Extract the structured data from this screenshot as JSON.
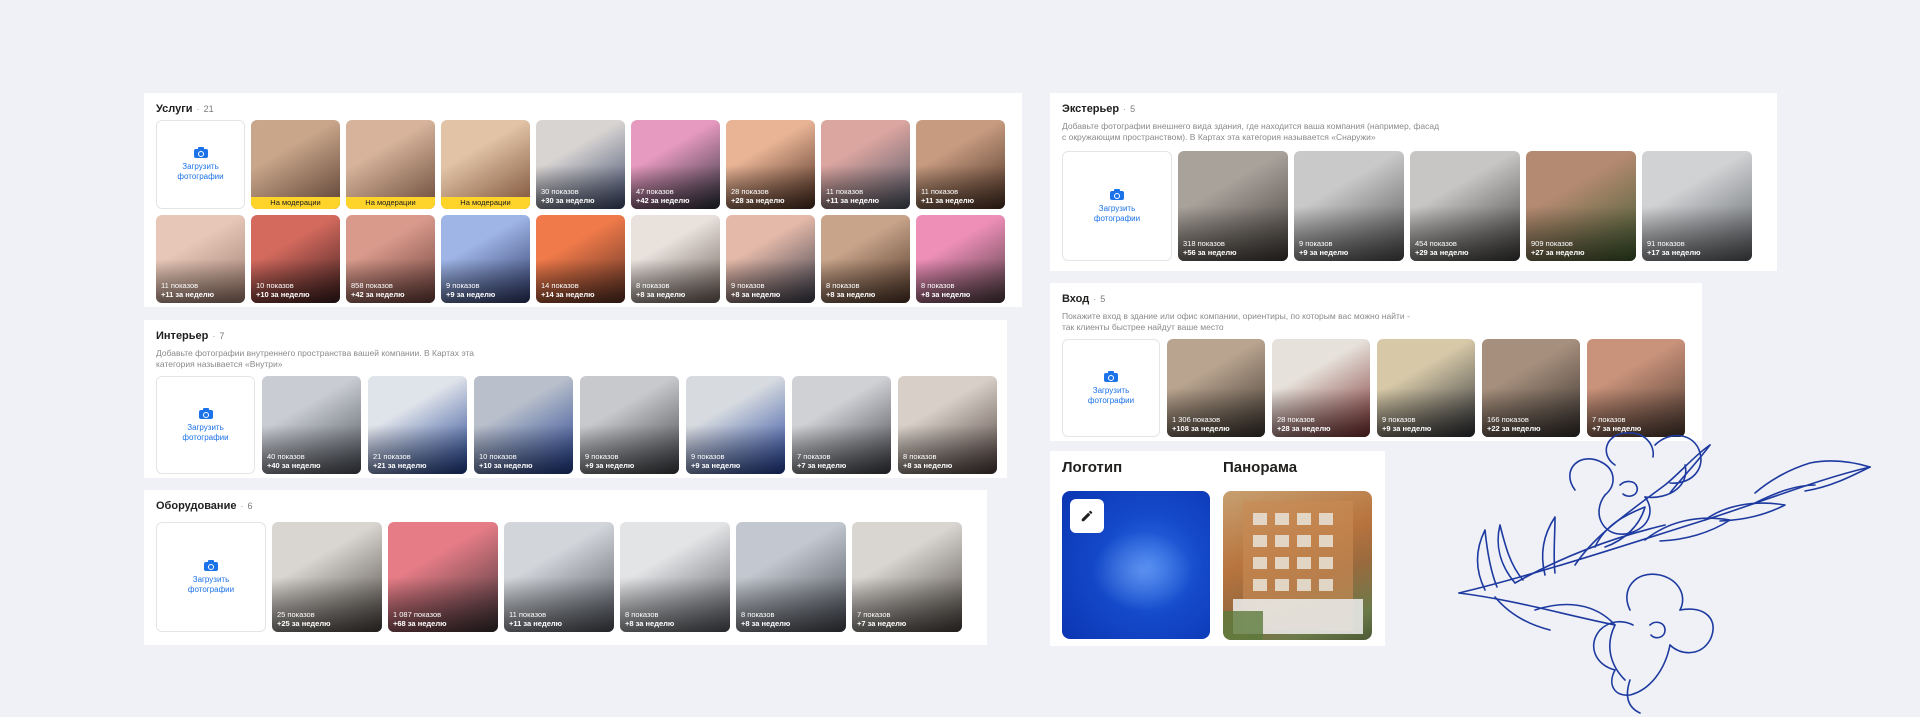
{
  "colors": {
    "accent": "#1c72e8",
    "moderation": "#fed42b",
    "background": "#eff1f6",
    "flower": "#1e3aa0"
  },
  "upload_label": "Загрузить фотографии",
  "sections": {
    "services": {
      "title": "Услуги",
      "count": "21",
      "tiles": [
        {
          "views": "",
          "week": "",
          "moderation": "На модерации",
          "c1": "#c9a68a",
          "c2": "#5b4033"
        },
        {
          "views": "",
          "week": "",
          "moderation": "На модерации",
          "c1": "#d6b39a",
          "c2": "#6a4a3a"
        },
        {
          "views": "",
          "week": "",
          "moderation": "На модерации",
          "c1": "#e2c3a6",
          "c2": "#7a5037"
        },
        {
          "views": "30 показов",
          "week": "+30 за неделю",
          "moderation": "",
          "c1": "#d8d4d2",
          "c2": "#3e4b6d"
        },
        {
          "views": "47 показов",
          "week": "+42 за неделю",
          "moderation": "",
          "c1": "#e79ac0",
          "c2": "#2c2f3a"
        },
        {
          "views": "28 показов",
          "week": "+28 за неделю",
          "moderation": "",
          "c1": "#e9b496",
          "c2": "#4a2c1e"
        },
        {
          "views": "11 показов",
          "week": "+11 за неделю",
          "moderation": "",
          "c1": "#dba5a0",
          "c2": "#4d5563"
        },
        {
          "views": "11 показов",
          "week": "+11 за неделю",
          "moderation": "",
          "c1": "#c69b80",
          "c2": "#4b3022"
        },
        {
          "views": "11 показов",
          "week": "+11 за неделю",
          "moderation": "",
          "c1": "#e7c8b8",
          "c2": "#9b7a6c"
        },
        {
          "views": "10 показов",
          "week": "+10 за неделю",
          "moderation": "",
          "c1": "#d46a5e",
          "c2": "#3b1d1d"
        },
        {
          "views": "858 показов",
          "week": "+42 за неделю",
          "moderation": "",
          "c1": "#d99a8c",
          "c2": "#6b3f3a"
        },
        {
          "views": "9 показов",
          "week": "+9 за неделю",
          "moderation": "",
          "c1": "#9fb5e6",
          "c2": "#2b3766"
        },
        {
          "views": "14 показов",
          "week": "+14 за неделю",
          "moderation": "",
          "c1": "#f07a4a",
          "c2": "#5a3023"
        },
        {
          "views": "8 показов",
          "week": "+8 за неделю",
          "moderation": "",
          "c1": "#e8e1dc",
          "c2": "#6d5e57"
        },
        {
          "views": "9 показов",
          "week": "+8 за неделю",
          "moderation": "",
          "c1": "#e4b9a9",
          "c2": "#3a3c4a"
        },
        {
          "views": "8 показов",
          "week": "+8 за неделю",
          "moderation": "",
          "c1": "#c8a48a",
          "c2": "#4f3526"
        },
        {
          "views": "8 показов",
          "week": "+8 за неделю",
          "moderation": "",
          "c1": "#ee8fb8",
          "c2": "#4c3a3f"
        }
      ]
    },
    "interior": {
      "title": "Интерьер",
      "count": "7",
      "desc": "Добавьте фотографии внутреннего пространства вашей компании. В Картах эта категория называется «Внутри»",
      "tiles": [
        {
          "views": "40 показов",
          "week": "+40 за неделю",
          "c1": "#c9ccd3",
          "c2": "#4b4f57"
        },
        {
          "views": "21 показов",
          "week": "+21 за неделю",
          "c1": "#dfe3ea",
          "c2": "#1b3d8f"
        },
        {
          "views": "10 показов",
          "week": "+10 за неделю",
          "c1": "#b9c0cc",
          "c2": "#1c3a8c"
        },
        {
          "views": "9 показов",
          "week": "+9 за неделю",
          "c1": "#c7c9cc",
          "c2": "#3d3f44"
        },
        {
          "views": "9 показов",
          "week": "+9 за неделю",
          "c1": "#d7dbe0",
          "c2": "#1e3f9a"
        },
        {
          "views": "7 показов",
          "week": "+7 за неделю",
          "c1": "#cfd1d5",
          "c2": "#3e4046"
        },
        {
          "views": "8 показов",
          "week": "+8 за неделю",
          "c1": "#d8d0c8",
          "c2": "#4a3b38"
        }
      ]
    },
    "equipment": {
      "title": "Оборудование",
      "count": "6",
      "tiles": [
        {
          "views": "25 показов",
          "week": "+25 за неделю",
          "c1": "#d9d6d2",
          "c2": "#47413c"
        },
        {
          "views": "1 087 показов",
          "week": "+68 за неделю",
          "c1": "#e57c86",
          "c2": "#3a3033"
        },
        {
          "views": "11 показов",
          "week": "+11 за неделю",
          "c1": "#d2d5da",
          "c2": "#4c5058"
        },
        {
          "views": "8 показов",
          "week": "+8 за неделю",
          "c1": "#e3e4e6",
          "c2": "#55585e"
        },
        {
          "views": "8 показов",
          "week": "+8 за неделю",
          "c1": "#c3c7cf",
          "c2": "#43474f"
        },
        {
          "views": "7 показов",
          "week": "+7 за неделю",
          "c1": "#d9d6d2",
          "c2": "#47413c"
        }
      ]
    },
    "exterior": {
      "title": "Экстерьер",
      "count": "5",
      "desc": "Добавьте фотографии внешнего вида здания, где находится ваша компания (например, фасад с окружающим пространством). В Картах эта категория называется «Снаружи»",
      "tiles": [
        {
          "views": "318 показов",
          "week": "+56 за неделю",
          "c1": "#a9a29b",
          "c2": "#3f3a36"
        },
        {
          "views": "9 показов",
          "week": "+9 за неделю",
          "c1": "#c9c9c9",
          "c2": "#4d4d4d"
        },
        {
          "views": "454 показов",
          "week": "+29 за неделю",
          "c1": "#c7c6c4",
          "c2": "#3c3b39"
        },
        {
          "views": "909 показов",
          "week": "+27 за неделю",
          "c1": "#b58a72",
          "c2": "#3e5a2e"
        },
        {
          "views": "91 показов",
          "week": "+17 за неделю",
          "c1": "#d0d2d4",
          "c2": "#595c60"
        }
      ]
    },
    "entrance": {
      "title": "Вход",
      "count": "5",
      "desc": "Покажите вход в здание или офис компании, ориентиры, по которым вас можно найти - так клиенты быстрее найдут ваше место",
      "tiles": [
        {
          "views": "1 306 показов",
          "week": "+108 за неделю",
          "c1": "#b9a48f",
          "c2": "#3d352e"
        },
        {
          "views": "28 показов",
          "week": "+28 за неделю",
          "c1": "#e6e1da",
          "c2": "#7a2f2f"
        },
        {
          "views": "9 показов",
          "week": "+9 за неделю",
          "c1": "#d7c9a8",
          "c2": "#2f3237"
        },
        {
          "views": "166 показов",
          "week": "+22 за неделю",
          "c1": "#a78f7d",
          "c2": "#35302c"
        },
        {
          "views": "7 показов",
          "week": "+7 за неделю",
          "c1": "#c9927a",
          "c2": "#4d3a31"
        }
      ]
    },
    "logo": {
      "title": "Логотип",
      "edit_icon": "pencil-icon"
    },
    "panorama": {
      "title": "Панорама"
    }
  }
}
